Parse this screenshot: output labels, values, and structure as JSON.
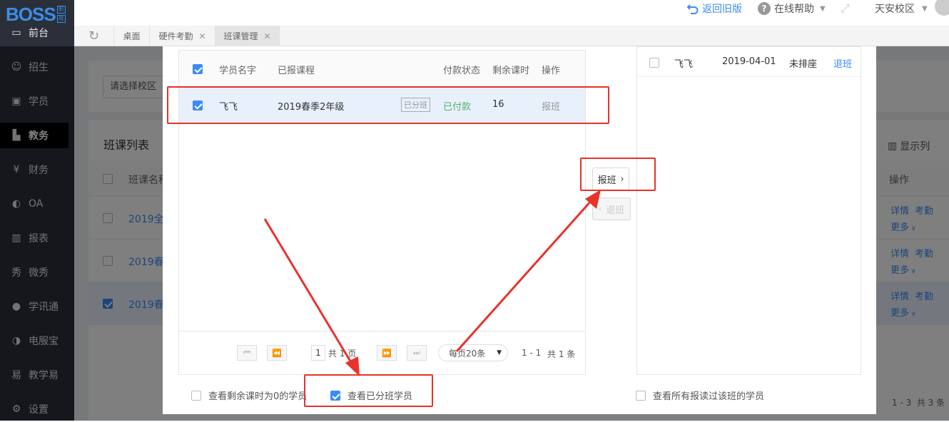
{
  "app": {
    "logo_text": "BOSS",
    "logo_badge": [
      "职",
      "校"
    ]
  },
  "sidebar": {
    "items": [
      {
        "label": "前台",
        "icon": "front-desk-icon",
        "glyph": "▭"
      },
      {
        "label": "招生",
        "icon": "recruit-icon",
        "glyph": "☺"
      },
      {
        "label": "学员",
        "icon": "student-icon",
        "glyph": "▣"
      },
      {
        "label": "教务",
        "icon": "academic-icon",
        "glyph": "▙"
      },
      {
        "label": "财务",
        "icon": "finance-icon",
        "glyph": "¥"
      },
      {
        "label": "OA",
        "icon": "oa-icon",
        "glyph": "◐"
      },
      {
        "label": "报表",
        "icon": "report-icon",
        "glyph": "▥"
      },
      {
        "label": "微秀",
        "icon": "weixiu-icon",
        "glyph": "秀"
      },
      {
        "label": "学讯通",
        "icon": "location-icon",
        "glyph": "●"
      },
      {
        "label": "电服宝",
        "icon": "service-icon",
        "glyph": "◑"
      },
      {
        "label": "教学易",
        "icon": "teach-icon",
        "glyph": "易"
      },
      {
        "label": "设置",
        "icon": "settings-icon",
        "glyph": "⚙"
      }
    ],
    "active_index": 3
  },
  "topbar": {
    "old_version": "返回旧版",
    "help": "在线帮助",
    "campus": "天安校区"
  },
  "tabs": [
    {
      "label": "桌面",
      "closable": false
    },
    {
      "label": "硬件考勤",
      "closable": true
    },
    {
      "label": "班课管理",
      "closable": true
    }
  ],
  "background": {
    "campus_select": "请选择校区",
    "list_title": "班课列表",
    "display_columns": "显示列",
    "col_name": "班课名称",
    "col_action": "操作",
    "rows": [
      {
        "name": "2019全",
        "checked": false
      },
      {
        "name": "2019春",
        "checked": false
      },
      {
        "name": "2019春",
        "checked": true
      }
    ],
    "row_detail": "详情",
    "row_attend": "考勤",
    "row_more": "更多",
    "pagination": "1 - 3  共 3 条"
  },
  "modal": {
    "left_table": {
      "headers": {
        "name": "学员名字",
        "course": "已报课程",
        "pay": "付款状态",
        "remain": "剩余课时",
        "action": "操作"
      },
      "rows": [
        {
          "name": "飞飞",
          "course": "2019春季2年级",
          "tag": "已分班",
          "pay": "已付款",
          "remain": "16",
          "action": "报班",
          "checked": true
        }
      ],
      "pagination": {
        "current": "1",
        "total_pages": "共 1 页",
        "per_page": "每页20条",
        "range": "1 - 1",
        "total": "共 1 条"
      }
    },
    "enroll_button": "报班",
    "withdraw_button": "退班",
    "right_table": {
      "rows": [
        {
          "name": "飞飞",
          "date": "2019-04-01",
          "seat": "未排座",
          "action": "退班",
          "checked": false
        }
      ]
    },
    "options": {
      "zero_hours": {
        "label": "查看剩余课时为0的学员",
        "checked": false
      },
      "assigned": {
        "label": "查看已分班学员",
        "checked": true
      },
      "all_history": {
        "label": "查看所有报读过该班的学员",
        "checked": false
      }
    }
  },
  "colors": {
    "accent": "#3c8bf5",
    "paid_green": "#52b365",
    "annotation_red": "#e8322b",
    "sidebar_bg": "#2b2f3a"
  }
}
